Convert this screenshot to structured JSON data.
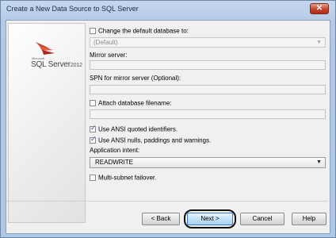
{
  "window": {
    "title": "Create a New Data Source to SQL Server",
    "close_glyph": "✕"
  },
  "logo": {
    "small": "Microsoft",
    "name": "SQL Server",
    "year": "2012"
  },
  "form": {
    "change_default_db": {
      "label": "Change the default database to:",
      "checked": false
    },
    "default_db_value": "(Default)",
    "mirror_server": {
      "label": "Mirror server:",
      "value": ""
    },
    "spn_mirror": {
      "label": "SPN for mirror server (Optional):",
      "value": ""
    },
    "attach_db": {
      "label": "Attach database filename:",
      "checked": false,
      "value": ""
    },
    "ansi_quoted": {
      "label": "Use ANSI quoted identifiers.",
      "checked": true
    },
    "ansi_nulls": {
      "label": "Use ANSI nulls, paddings and warnings.",
      "checked": true
    },
    "app_intent": {
      "label": "Application intent:",
      "value": "READWRITE"
    },
    "multi_subnet": {
      "label": "Multi-subnet failover.",
      "checked": false
    }
  },
  "buttons": {
    "back": "< Back",
    "next": "Next >",
    "cancel": "Cancel",
    "help": "Help"
  },
  "icons": {
    "close": "close-icon",
    "dropdown": "chevron-down-icon",
    "logo": "sql-server-logo-icon"
  }
}
